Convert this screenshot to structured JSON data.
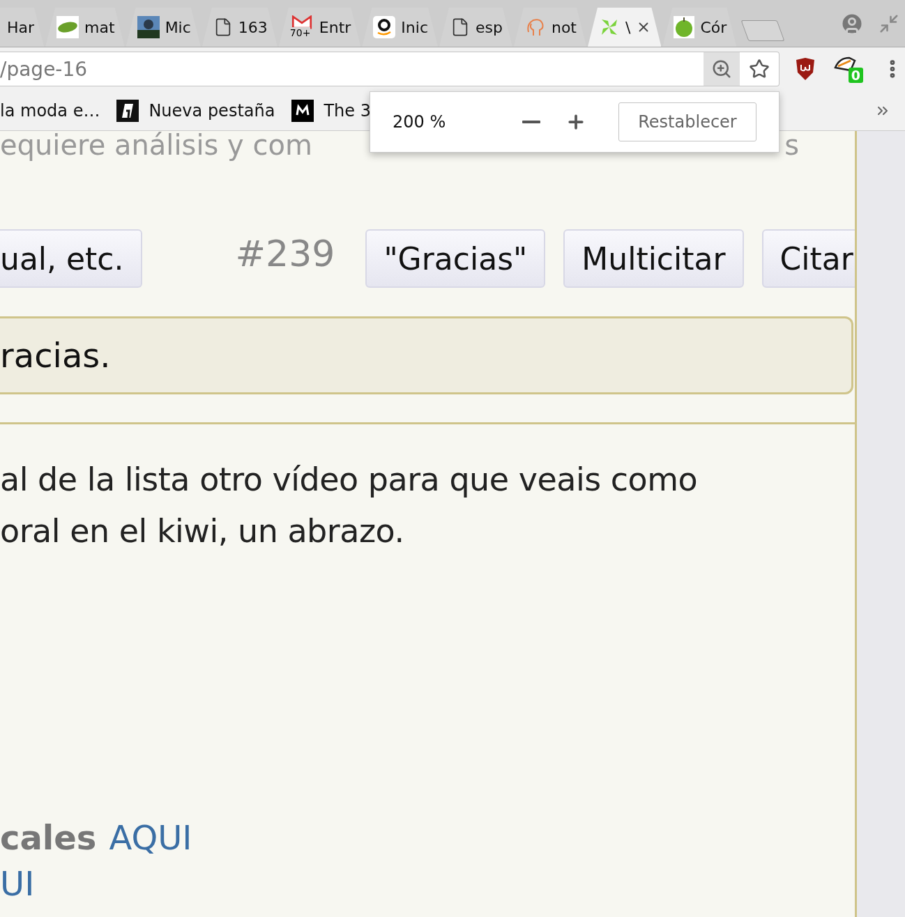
{
  "tabs": [
    {
      "label": "Har",
      "selected": false
    },
    {
      "label": "mat",
      "selected": false
    },
    {
      "label": "Mic",
      "selected": false
    },
    {
      "label": "163",
      "selected": false
    },
    {
      "label": "Entr",
      "badge": "70+",
      "selected": false
    },
    {
      "label": "Inic",
      "selected": false
    },
    {
      "label": "esp",
      "selected": false
    },
    {
      "label": "not",
      "selected": false
    },
    {
      "label": "\\",
      "selected": true
    },
    {
      "label": "Cór",
      "selected": false
    }
  ],
  "address": {
    "url": "/page-16"
  },
  "extension_badge": "0",
  "bookmarks": [
    "la moda e…",
    "Nueva pestaña",
    "The 3"
  ],
  "zoom_popup": {
    "value": "200 %",
    "reset": "Restablecer"
  },
  "post": {
    "heading_left": "equiere análisis y com",
    "heading_right": "s",
    "left_button": "ual, etc.",
    "number": "#239",
    "buttons": [
      "\"Gracias\"",
      "Multicitar",
      "Citar"
    ],
    "quote": "racias.",
    "lines": [
      "al de la lista otro vídeo para que veais como",
      "oral en el kiwi, un abrazo."
    ],
    "link_line": {
      "bold": "cales",
      "link": "AQUI"
    },
    "link_line_2": "UI"
  }
}
